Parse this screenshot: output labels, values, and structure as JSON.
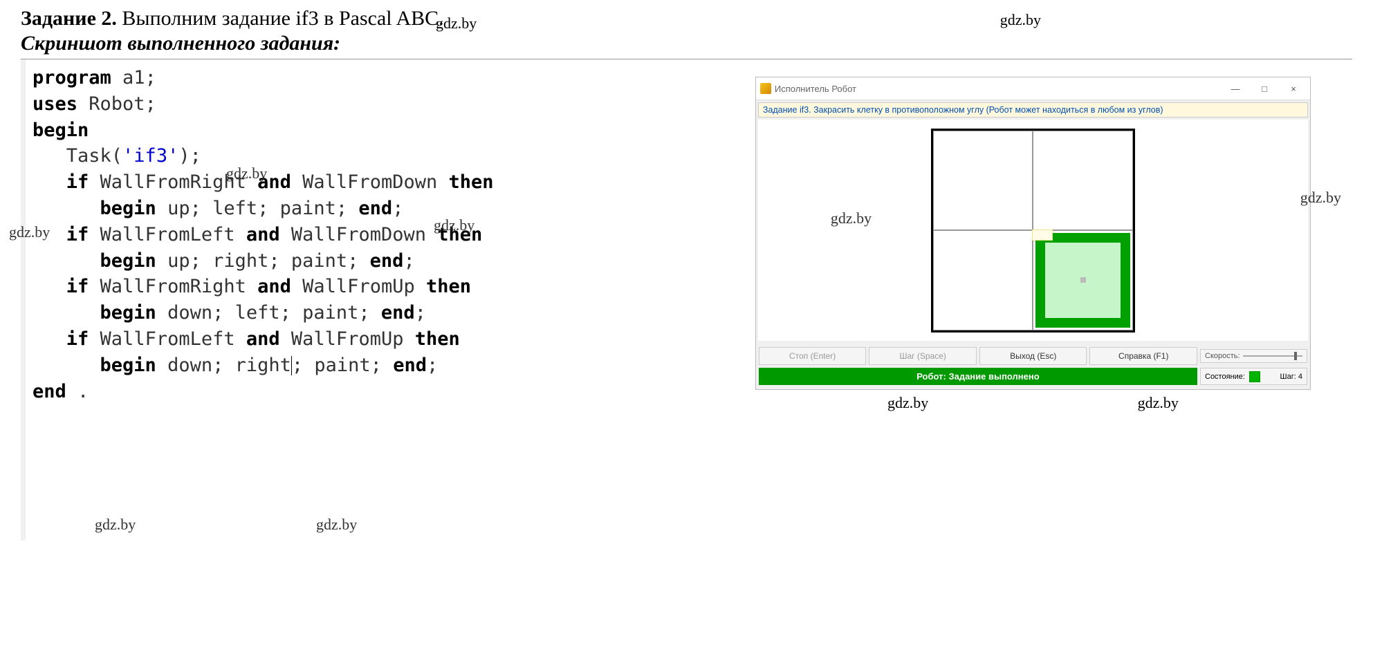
{
  "header": {
    "bold": "Задание 2.",
    "rest": " Выполним задание if3 в Pascal ABC.",
    "watermark": "gdz.by"
  },
  "subtitle": "Скриншот выполненного задания:",
  "code": {
    "l1a": "program",
    "l1b": " a1;",
    "l2a": "uses",
    "l2b": " Robot;",
    "l3": "begin",
    "l4a": "   Task(",
    "l4s": "'if3'",
    "l4b": ");",
    "l5a": "   if ",
    "l5b": "WallFromRight ",
    "l5and": "and",
    "l5c": " WallFromDown ",
    "l5then": "then",
    "l6a": "      begin",
    "l6b": " up; left; paint; ",
    "l6c": "end",
    "l6d": ";",
    "l7a": "   if ",
    "l7b": "WallFromLeft ",
    "l7and": "and",
    "l7c": " WallFromDown ",
    "l7then": "then",
    "l8a": "      begin",
    "l8b": " up; right; paint; ",
    "l8c": "end",
    "l8d": ";",
    "l9a": "   if ",
    "l9b": "WallFromRight ",
    "l9and": "and",
    "l9c": " WallFromUp ",
    "l9then": "then",
    "l10a": "      begin",
    "l10b": " down; left; paint; ",
    "l10c": "end",
    "l10d": ";",
    "l11a": "   if ",
    "l11b": "WallFromLeft ",
    "l11and": "and",
    "l11c": " WallFromUp ",
    "l11then": "then",
    "l12a": "      begin",
    "l12b": " down; right",
    "l12b2": "; paint; ",
    "l12c": "end",
    "l12d": ";",
    "l13": "end",
    "l13b": " ."
  },
  "robot": {
    "title": "Исполнитель Робот",
    "task": "Задание if3. Закрасить клетку в противоположном углу (Робот может находиться в любом из углов)",
    "buttons": {
      "stop": "Стоп (Enter)",
      "step": "Шаг (Space)",
      "exit": "Выход (Esc)",
      "help": "Справка (F1)"
    },
    "speed_label": "Скорость:",
    "status": "Робот: Задание выполнено",
    "state_label": "Состояние:",
    "step_label": "Шаг: 4",
    "min": "—",
    "box": "□",
    "close": "×"
  },
  "gdz": "gdz.by"
}
